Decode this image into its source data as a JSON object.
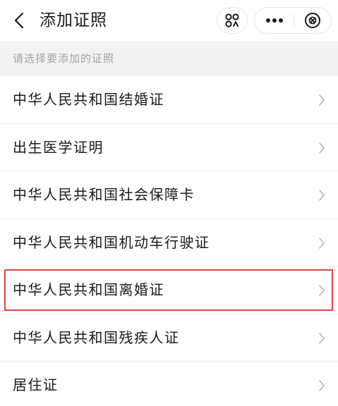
{
  "header": {
    "title": "添加证照",
    "back_icon": "chevron-left-icon",
    "scan_icon": "scan-code-icon",
    "more_icon": "more-dots-icon",
    "close_icon": "circle-close-icon"
  },
  "hint": "请选择要添加的证照",
  "list": {
    "items": [
      {
        "label": "中华人民共和国结婚证",
        "highlighted": false
      },
      {
        "label": "出生医学证明",
        "highlighted": false
      },
      {
        "label": "中华人民共和国社会保障卡",
        "highlighted": false
      },
      {
        "label": "中华人民共和国机动车行驶证",
        "highlighted": false
      },
      {
        "label": "中华人民共和国离婚证",
        "highlighted": true
      },
      {
        "label": "中华人民共和国残疾人证",
        "highlighted": false
      },
      {
        "label": "居住证",
        "highlighted": false
      }
    ]
  },
  "colors": {
    "highlight_border": "#e04646",
    "hint_background": "#f2f2f2",
    "hint_text": "#a3a3a3"
  }
}
